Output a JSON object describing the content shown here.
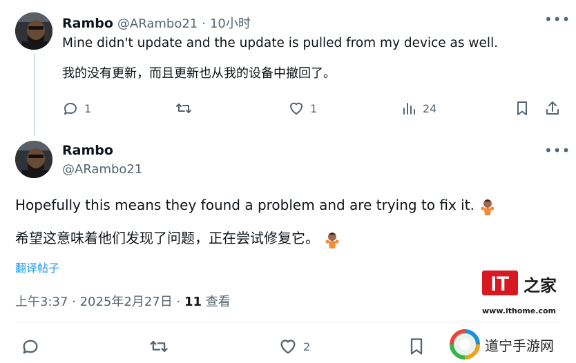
{
  "tweet1": {
    "name": "Rambo",
    "handle": "@ARambo21",
    "separator": "·",
    "time": "10小时",
    "text_en": "Mine didn't update and the update is pulled from my device as well.",
    "text_zh": "我的没有更新，而且更新也从我的设备中撤回了。",
    "replies": "1",
    "likes": "1",
    "views": "24"
  },
  "tweet2": {
    "name": "Rambo",
    "handle": "@ARambo21",
    "text_en": "Hopefully this means they found a problem and are trying to fix it.",
    "text_zh": "希望这意味着他们发现了问题，正在尝试修复它。",
    "translate_link": "翻译帖子",
    "time": "上午3:37 · 2025年2月27日 ·",
    "views_count": "11",
    "views_label": "查看",
    "likes": "2"
  },
  "watermarks": {
    "ithome_logo": "IT之家",
    "ithome_url": "www.ithome.com",
    "daoning": "道宁手游网"
  },
  "colors": {
    "text": "#0f1419",
    "secondary": "#536471",
    "link": "#1d9bf0",
    "ithome_red": "#d71921"
  }
}
